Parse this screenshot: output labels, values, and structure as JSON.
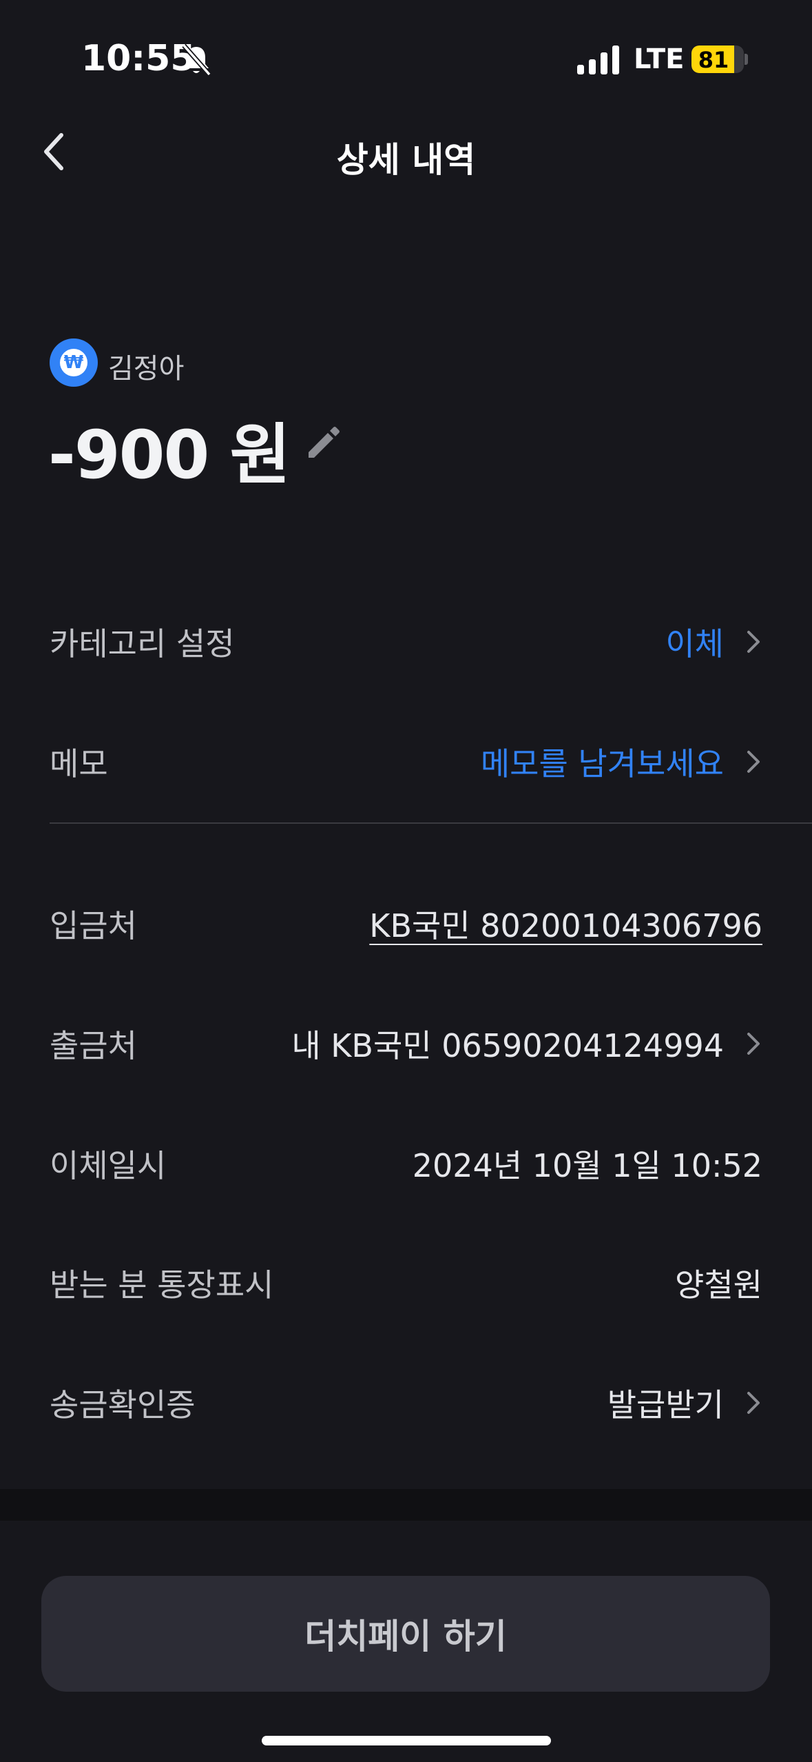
{
  "status_bar": {
    "time": "10:55",
    "network": "LTE",
    "battery_level": "81",
    "battery_fraction": 0.81
  },
  "nav": {
    "title": "상세 내역"
  },
  "header": {
    "account_name": "김정아",
    "amount": "-900 원"
  },
  "rows": {
    "category": {
      "label": "카테고리 설정",
      "value": "이체"
    },
    "memo": {
      "label": "메모",
      "value": "메모를 남겨보세요"
    },
    "deposit_to": {
      "label": "입금처",
      "value": "KB국민 80200104306796"
    },
    "withdraw_from": {
      "label": "출금처",
      "value": "내 KB국민 06590204124994"
    },
    "transfer_datetime": {
      "label": "이체일시",
      "value": "2024년 10월 1일 10:52"
    },
    "recipient_display": {
      "label": "받는 분 통장표시",
      "value": "양철원"
    },
    "remittance_certificate": {
      "label": "송금확인증",
      "value": "발급받기"
    }
  },
  "actions": {
    "dutch_pay_label": "더치페이 하기"
  },
  "colors": {
    "background": "#17171C",
    "accent_blue": "#3182F6",
    "battery_yellow": "#FFD60A",
    "button_bg": "#2C2C35"
  }
}
